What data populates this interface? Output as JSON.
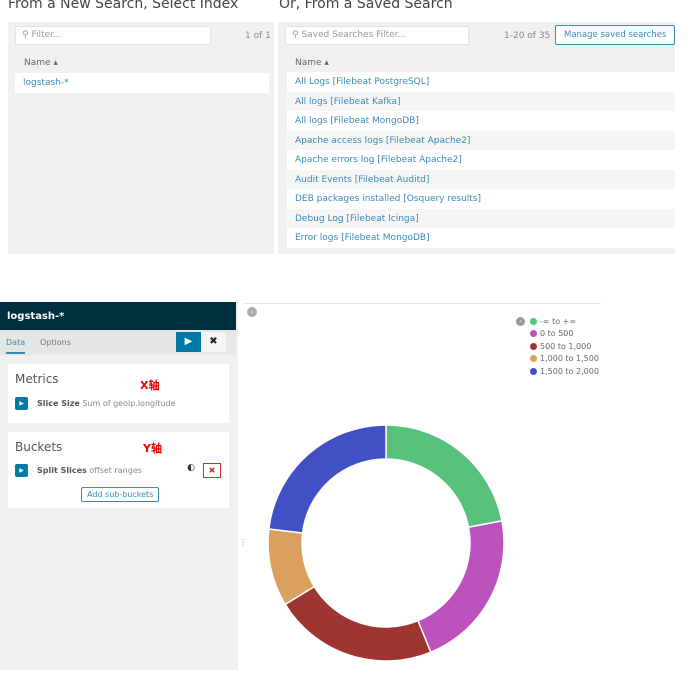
{
  "index_section": {
    "title": "From a New Search, Select Index",
    "filter_placeholder": "Filter...",
    "count": "1 of 1",
    "column": "Name",
    "items": [
      "logstash-*"
    ]
  },
  "saved_section": {
    "title": "Or, From a Saved Search",
    "filter_placeholder": "Saved Searches Filter...",
    "count": "1-20 of 35",
    "manage_label": "Manage saved searches",
    "column": "Name",
    "items": [
      "All Logs [Filebeat PostgreSQL]",
      "All logs [Filebeat Kafka]",
      "All logs [Filebeat MongoDB]",
      "Apache access logs [Filebeat Apache2]",
      "Apache errors log [Filebeat Apache2]",
      "Audit Events [Filebeat Auditd]",
      "DEB packages installed [Osquery results]",
      "Debug Log [Filebeat Icinga]",
      "Error logs [Filebeat MongoDB]"
    ]
  },
  "editor": {
    "index": "logstash-*",
    "tabs": [
      "Data",
      "Options"
    ],
    "active_tab": "Data",
    "metrics": {
      "title": "Metrics",
      "annotation": "X轴",
      "agg_label": "Slice Size",
      "agg_desc": "Sum of geoip.longitude"
    },
    "buckets": {
      "title": "Buckets",
      "annotation": "Y轴",
      "agg_label": "Split Slices",
      "agg_desc": "offset ranges",
      "add_label": "Add sub-buckets"
    }
  },
  "chart_data": {
    "type": "pie",
    "donut": true,
    "categories": [
      "-∞ to +∞",
      "0 to 500",
      "500 to 1,000",
      "1,000 to 1,500",
      "1,500 to 2,000"
    ],
    "values": [
      22,
      21.8,
      22.5,
      10.6,
      23.1
    ],
    "colors": [
      "#57c17b",
      "#bc52bc",
      "#9e3533",
      "#daa05d",
      "#4150c4"
    ],
    "legend": "top-right"
  }
}
